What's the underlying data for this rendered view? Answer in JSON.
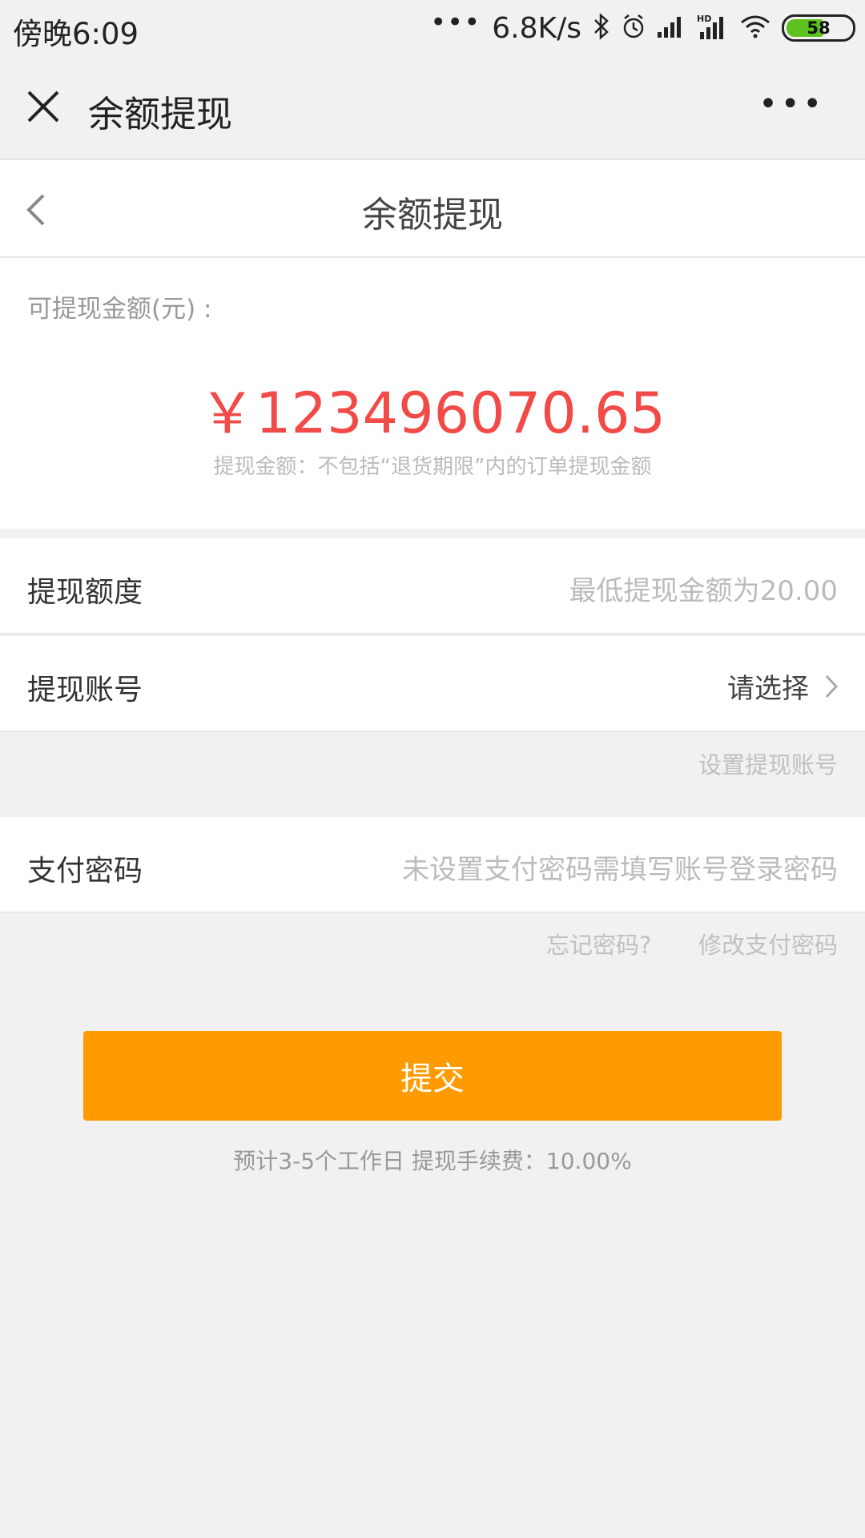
{
  "status_bar": {
    "time": "傍晚6:09",
    "dots": "•••",
    "speed": "6.8K/s",
    "battery": "58",
    "icons": [
      "bluetooth-icon",
      "alarm-icon",
      "signal-icon",
      "hd-signal-icon",
      "wifi-icon",
      "battery-icon"
    ]
  },
  "title_bar": {
    "title": "余额提现",
    "more": "•••"
  },
  "nav": {
    "title": "余额提现"
  },
  "balance": {
    "label": "可提现金额(元) :",
    "amount": "￥123496070.65",
    "note": "提现金额：不包括“退货期限”内的订单提现金额"
  },
  "form": {
    "limit_label": "提现额度",
    "limit_placeholder": "最低提现金额为20.00",
    "account_label": "提现账号",
    "account_value": "请选择",
    "set_account_link": "设置提现账号",
    "password_label": "支付密码",
    "password_placeholder": "未设置支付密码需填写账号登录密码",
    "forgot_link": "忘记密码?",
    "change_link": "修改支付密码"
  },
  "submit_label": "提交",
  "footnote": "预计3-5个工作日   提现手续费：10.00%",
  "colors": {
    "accent": "#ff9a00",
    "amount": "#f24a47",
    "battery": "#5dc21e"
  }
}
